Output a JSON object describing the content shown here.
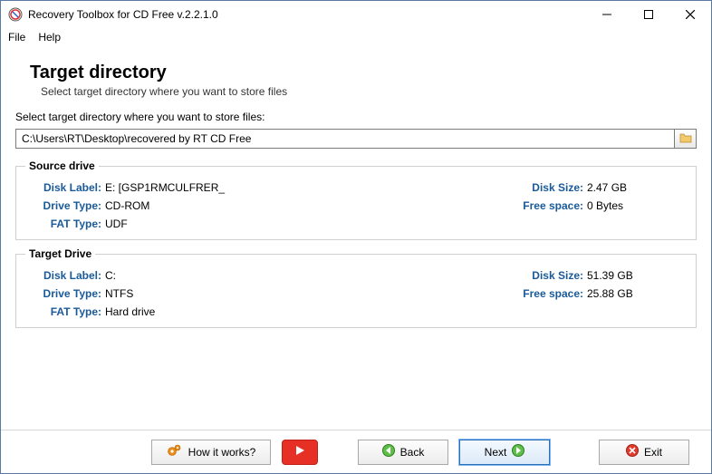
{
  "window": {
    "title": "Recovery Toolbox for CD Free v.2.2.1.0"
  },
  "menu": {
    "file": "File",
    "help": "Help"
  },
  "page": {
    "heading": "Target directory",
    "subheading": "Select target directory where you want to store files",
    "prompt": "Select target directory where you want to store files:",
    "path": "C:\\Users\\RT\\Desktop\\recovered by RT CD Free"
  },
  "source": {
    "legend": "Source drive",
    "disk_label_k": "Disk Label:",
    "disk_label_v": "E: [GSP1RMCULFRER_",
    "drive_type_k": "Drive Type:",
    "drive_type_v": "CD-ROM",
    "fat_type_k": "FAT Type:",
    "fat_type_v": "UDF",
    "disk_size_k": "Disk Size:",
    "disk_size_v": "2.47 GB",
    "free_space_k": "Free space:",
    "free_space_v": "0 Bytes"
  },
  "target": {
    "legend": "Target Drive",
    "disk_label_k": "Disk Label:",
    "disk_label_v": "C:",
    "drive_type_k": "Drive Type:",
    "drive_type_v": "NTFS",
    "fat_type_k": "FAT Type:",
    "fat_type_v": "Hard drive",
    "disk_size_k": "Disk Size:",
    "disk_size_v": "51.39 GB",
    "free_space_k": "Free space:",
    "free_space_v": "25.88 GB"
  },
  "buttons": {
    "how": "How it works?",
    "back": "Back",
    "next": "Next",
    "exit": "Exit"
  }
}
